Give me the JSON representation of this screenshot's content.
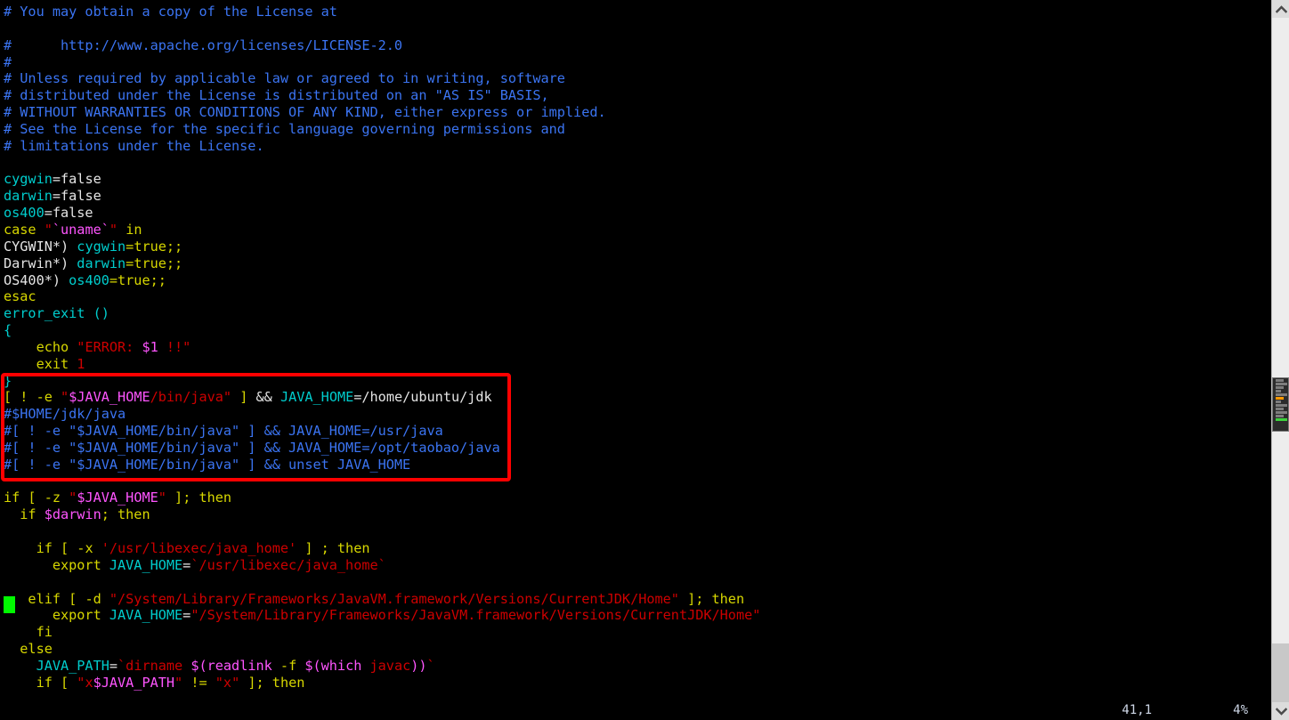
{
  "window": {
    "kind": "terminal-text-editor",
    "background": "#000000"
  },
  "editor": {
    "filetype": "shell-script",
    "lines": [
      {
        "id": 1,
        "segments": [
          {
            "t": "# You may obtain a copy of the License at",
            "c": "comment"
          }
        ]
      },
      {
        "id": 2,
        "segments": [
          {
            "t": "",
            "c": "norm"
          }
        ]
      },
      {
        "id": 3,
        "segments": [
          {
            "t": "#      http://www.apache.org/licenses/LICENSE-2.0",
            "c": "comment"
          }
        ]
      },
      {
        "id": 4,
        "segments": [
          {
            "t": "#",
            "c": "comment"
          }
        ]
      },
      {
        "id": 5,
        "segments": [
          {
            "t": "# Unless required by applicable law or agreed to in writing, software",
            "c": "comment"
          }
        ]
      },
      {
        "id": 6,
        "segments": [
          {
            "t": "# distributed under the License is distributed on an \"AS IS\" BASIS,",
            "c": "comment"
          }
        ]
      },
      {
        "id": 7,
        "segments": [
          {
            "t": "# WITHOUT WARRANTIES OR CONDITIONS OF ANY KIND, either express or implied.",
            "c": "comment"
          }
        ]
      },
      {
        "id": 8,
        "segments": [
          {
            "t": "# See the License for the specific language governing permissions and",
            "c": "comment"
          }
        ]
      },
      {
        "id": 9,
        "segments": [
          {
            "t": "# limitations under the License.",
            "c": "comment"
          }
        ]
      },
      {
        "id": 10,
        "segments": [
          {
            "t": "",
            "c": "norm"
          }
        ]
      },
      {
        "id": 11,
        "segments": [
          {
            "t": "cygwin",
            "c": "ident"
          },
          {
            "t": "=false",
            "c": "norm"
          }
        ]
      },
      {
        "id": 12,
        "segments": [
          {
            "t": "darwin",
            "c": "ident"
          },
          {
            "t": "=false",
            "c": "norm"
          }
        ]
      },
      {
        "id": 13,
        "segments": [
          {
            "t": "os400",
            "c": "ident"
          },
          {
            "t": "=false",
            "c": "norm"
          }
        ]
      },
      {
        "id": 14,
        "segments": [
          {
            "t": "case ",
            "c": "stmt"
          },
          {
            "t": "\"",
            "c": "str"
          },
          {
            "t": "`uname`",
            "c": "const"
          },
          {
            "t": "\"",
            "c": "str"
          },
          {
            "t": " in",
            "c": "stmt"
          }
        ]
      },
      {
        "id": 15,
        "segments": [
          {
            "t": "CYGWIN*) ",
            "c": "norm"
          },
          {
            "t": "cygwin",
            "c": "ident"
          },
          {
            "t": "=true;;",
            "c": "stmt"
          }
        ]
      },
      {
        "id": 16,
        "segments": [
          {
            "t": "Darwin*) ",
            "c": "norm"
          },
          {
            "t": "darwin",
            "c": "ident"
          },
          {
            "t": "=true;;",
            "c": "stmt"
          }
        ]
      },
      {
        "id": 17,
        "segments": [
          {
            "t": "OS400*) ",
            "c": "norm"
          },
          {
            "t": "os400",
            "c": "ident"
          },
          {
            "t": "=true;;",
            "c": "stmt"
          }
        ]
      },
      {
        "id": 18,
        "segments": [
          {
            "t": "esac",
            "c": "stmt"
          }
        ]
      },
      {
        "id": 19,
        "segments": [
          {
            "t": "error_exit ()",
            "c": "ident"
          }
        ]
      },
      {
        "id": 20,
        "segments": [
          {
            "t": "{",
            "c": "ident"
          }
        ]
      },
      {
        "id": 21,
        "segments": [
          {
            "t": "    echo ",
            "c": "stmt"
          },
          {
            "t": "\"ERROR: ",
            "c": "str"
          },
          {
            "t": "$1",
            "c": "const"
          },
          {
            "t": " !!\"",
            "c": "str"
          }
        ]
      },
      {
        "id": 22,
        "segments": [
          {
            "t": "    exit ",
            "c": "stmt"
          },
          {
            "t": "1",
            "c": "str"
          }
        ]
      },
      {
        "id": 23,
        "segments": [
          {
            "t": "}",
            "c": "ident"
          }
        ]
      },
      {
        "id": 24,
        "segments": [
          {
            "t": "[ ",
            "c": "stmt"
          },
          {
            "t": "! ",
            "c": "stmt"
          },
          {
            "t": "-e ",
            "c": "stmt"
          },
          {
            "t": "\"",
            "c": "str"
          },
          {
            "t": "$JAVA_HOME",
            "c": "const"
          },
          {
            "t": "/bin/java",
            "c": "str"
          },
          {
            "t": "\"",
            "c": "str"
          },
          {
            "t": " ] ",
            "c": "stmt"
          },
          {
            "t": "&& ",
            "c": "norm"
          },
          {
            "t": "JAVA_HOME",
            "c": "ident"
          },
          {
            "t": "=/home/ubuntu/jdk",
            "c": "norm"
          }
        ]
      },
      {
        "id": 25,
        "segments": [
          {
            "t": "#$HOME/jdk/java",
            "c": "comment"
          }
        ]
      },
      {
        "id": 26,
        "segments": [
          {
            "t": "#[ ! -e \"$JAVA_HOME/bin/java\" ] && JAVA_HOME=/usr/java",
            "c": "comment"
          }
        ]
      },
      {
        "id": 27,
        "segments": [
          {
            "t": "#[ ! -e \"$JAVA_HOME/bin/java\" ] && JAVA_HOME=/opt/taobao/java",
            "c": "comment"
          }
        ]
      },
      {
        "id": 28,
        "segments": [
          {
            "t": "#[ ! -e \"$JAVA_HOME/bin/java\" ] && unset JAVA_HOME",
            "c": "comment"
          }
        ]
      },
      {
        "id": 29,
        "segments": [
          {
            "t": "",
            "c": "norm"
          }
        ]
      },
      {
        "id": 30,
        "segments": [
          {
            "t": "if [ ",
            "c": "stmt"
          },
          {
            "t": "-z ",
            "c": "stmt"
          },
          {
            "t": "\"",
            "c": "str"
          },
          {
            "t": "$JAVA_HOME",
            "c": "const"
          },
          {
            "t": "\"",
            "c": "str"
          },
          {
            "t": " ]; then",
            "c": "stmt"
          }
        ]
      },
      {
        "id": 31,
        "segments": [
          {
            "t": "  if ",
            "c": "stmt"
          },
          {
            "t": "$darwin",
            "c": "const"
          },
          {
            "t": "; then",
            "c": "stmt"
          }
        ]
      },
      {
        "id": 32,
        "segments": [
          {
            "t": "",
            "c": "norm"
          }
        ]
      },
      {
        "id": 33,
        "segments": [
          {
            "t": "    if [ ",
            "c": "stmt"
          },
          {
            "t": "-x ",
            "c": "stmt"
          },
          {
            "t": "'/usr/libexec/java_home'",
            "c": "str"
          },
          {
            "t": " ] ; then",
            "c": "stmt"
          }
        ]
      },
      {
        "id": 34,
        "segments": [
          {
            "t": "      export ",
            "c": "stmt"
          },
          {
            "t": "JAVA_HOME",
            "c": "ident"
          },
          {
            "t": "=",
            "c": "norm"
          },
          {
            "t": "`/usr/libexec/java_home`",
            "c": "str"
          }
        ]
      },
      {
        "id": 35,
        "segments": [
          {
            "t": "",
            "c": "norm"
          }
        ]
      },
      {
        "id": 36,
        "segments": [
          {
            "t": "   elif [ ",
            "c": "stmt"
          },
          {
            "t": "-d ",
            "c": "stmt"
          },
          {
            "t": "\"/System/Library/Frameworks/JavaVM.framework/Versions/CurrentJDK/Home\"",
            "c": "str"
          },
          {
            "t": " ]; then",
            "c": "stmt"
          }
        ]
      },
      {
        "id": 37,
        "segments": [
          {
            "t": "      export ",
            "c": "stmt"
          },
          {
            "t": "JAVA_HOME",
            "c": "ident"
          },
          {
            "t": "=",
            "c": "norm"
          },
          {
            "t": "\"/System/Library/Frameworks/JavaVM.framework/Versions/CurrentJDK/Home\"",
            "c": "str"
          }
        ]
      },
      {
        "id": 38,
        "segments": [
          {
            "t": "    fi",
            "c": "stmt"
          }
        ]
      },
      {
        "id": 39,
        "segments": [
          {
            "t": "  else",
            "c": "stmt"
          }
        ]
      },
      {
        "id": 40,
        "segments": [
          {
            "t": "    JAVA_PATH",
            "c": "ident"
          },
          {
            "t": "=",
            "c": "norm"
          },
          {
            "t": "`dirname ",
            "c": "str"
          },
          {
            "t": "$(readlink ",
            "c": "const"
          },
          {
            "t": "-f ",
            "c": "stmt"
          },
          {
            "t": "$(which ",
            "c": "const"
          },
          {
            "t": "javac",
            "c": "str"
          },
          {
            "t": "))",
            "c": "const"
          },
          {
            "t": "`",
            "c": "str"
          }
        ]
      },
      {
        "id": 41,
        "segments": [
          {
            "t": "    if [ ",
            "c": "stmt"
          },
          {
            "t": "\"x",
            "c": "str"
          },
          {
            "t": "$JAVA_PATH",
            "c": "const"
          },
          {
            "t": "\"",
            "c": "str"
          },
          {
            "t": " != ",
            "c": "stmt"
          },
          {
            "t": "\"",
            "c": "str"
          },
          {
            "t": "x",
            "c": "str"
          },
          {
            "t": "\"",
            "c": "str"
          },
          {
            "t": " ]; then",
            "c": "stmt"
          }
        ]
      }
    ]
  },
  "statusline": {
    "cursor_position": "41,1",
    "scroll_percent": "4%"
  },
  "annotation": {
    "shape": "rectangle",
    "color": "#ff0000",
    "highlighted_lines": [
      "}",
      "[ ! -e \"$JAVA_HOME/bin/java\" ] && JAVA_HOME=/home/ubuntu/jdk",
      "#$HOME/jdk/java",
      "#[ ! -e \"$JAVA_HOME/bin/java\" ] && JAVA_HOME=/usr/java",
      "#[ ! -e \"$JAVA_HOME/bin/java\" ] && JAVA_HOME=/opt/taobao/java",
      "#[ ! -e \"$JAVA_HOME/bin/java\" ] && unset JAVA_HOME"
    ]
  },
  "scrollbar": {
    "up_arrow_icon": "chevron-up-icon",
    "down_arrow_icon": "chevron-down-icon",
    "thumb_minimap_rows": [
      {
        "w": "med",
        "color": "gray"
      },
      {
        "w": "long",
        "color": "gray"
      },
      {
        "w": "med",
        "color": "gray"
      },
      {
        "w": "short",
        "color": "gray"
      },
      {
        "w": "long",
        "color": "gray"
      },
      {
        "w": "med",
        "color": "orange"
      },
      {
        "w": "short",
        "color": "gray"
      },
      {
        "w": "long",
        "color": "gray"
      },
      {
        "w": "med",
        "color": "gray"
      },
      {
        "w": "long",
        "color": "gray"
      },
      {
        "w": "med",
        "color": "gray"
      },
      {
        "w": "long",
        "color": "green"
      }
    ]
  }
}
